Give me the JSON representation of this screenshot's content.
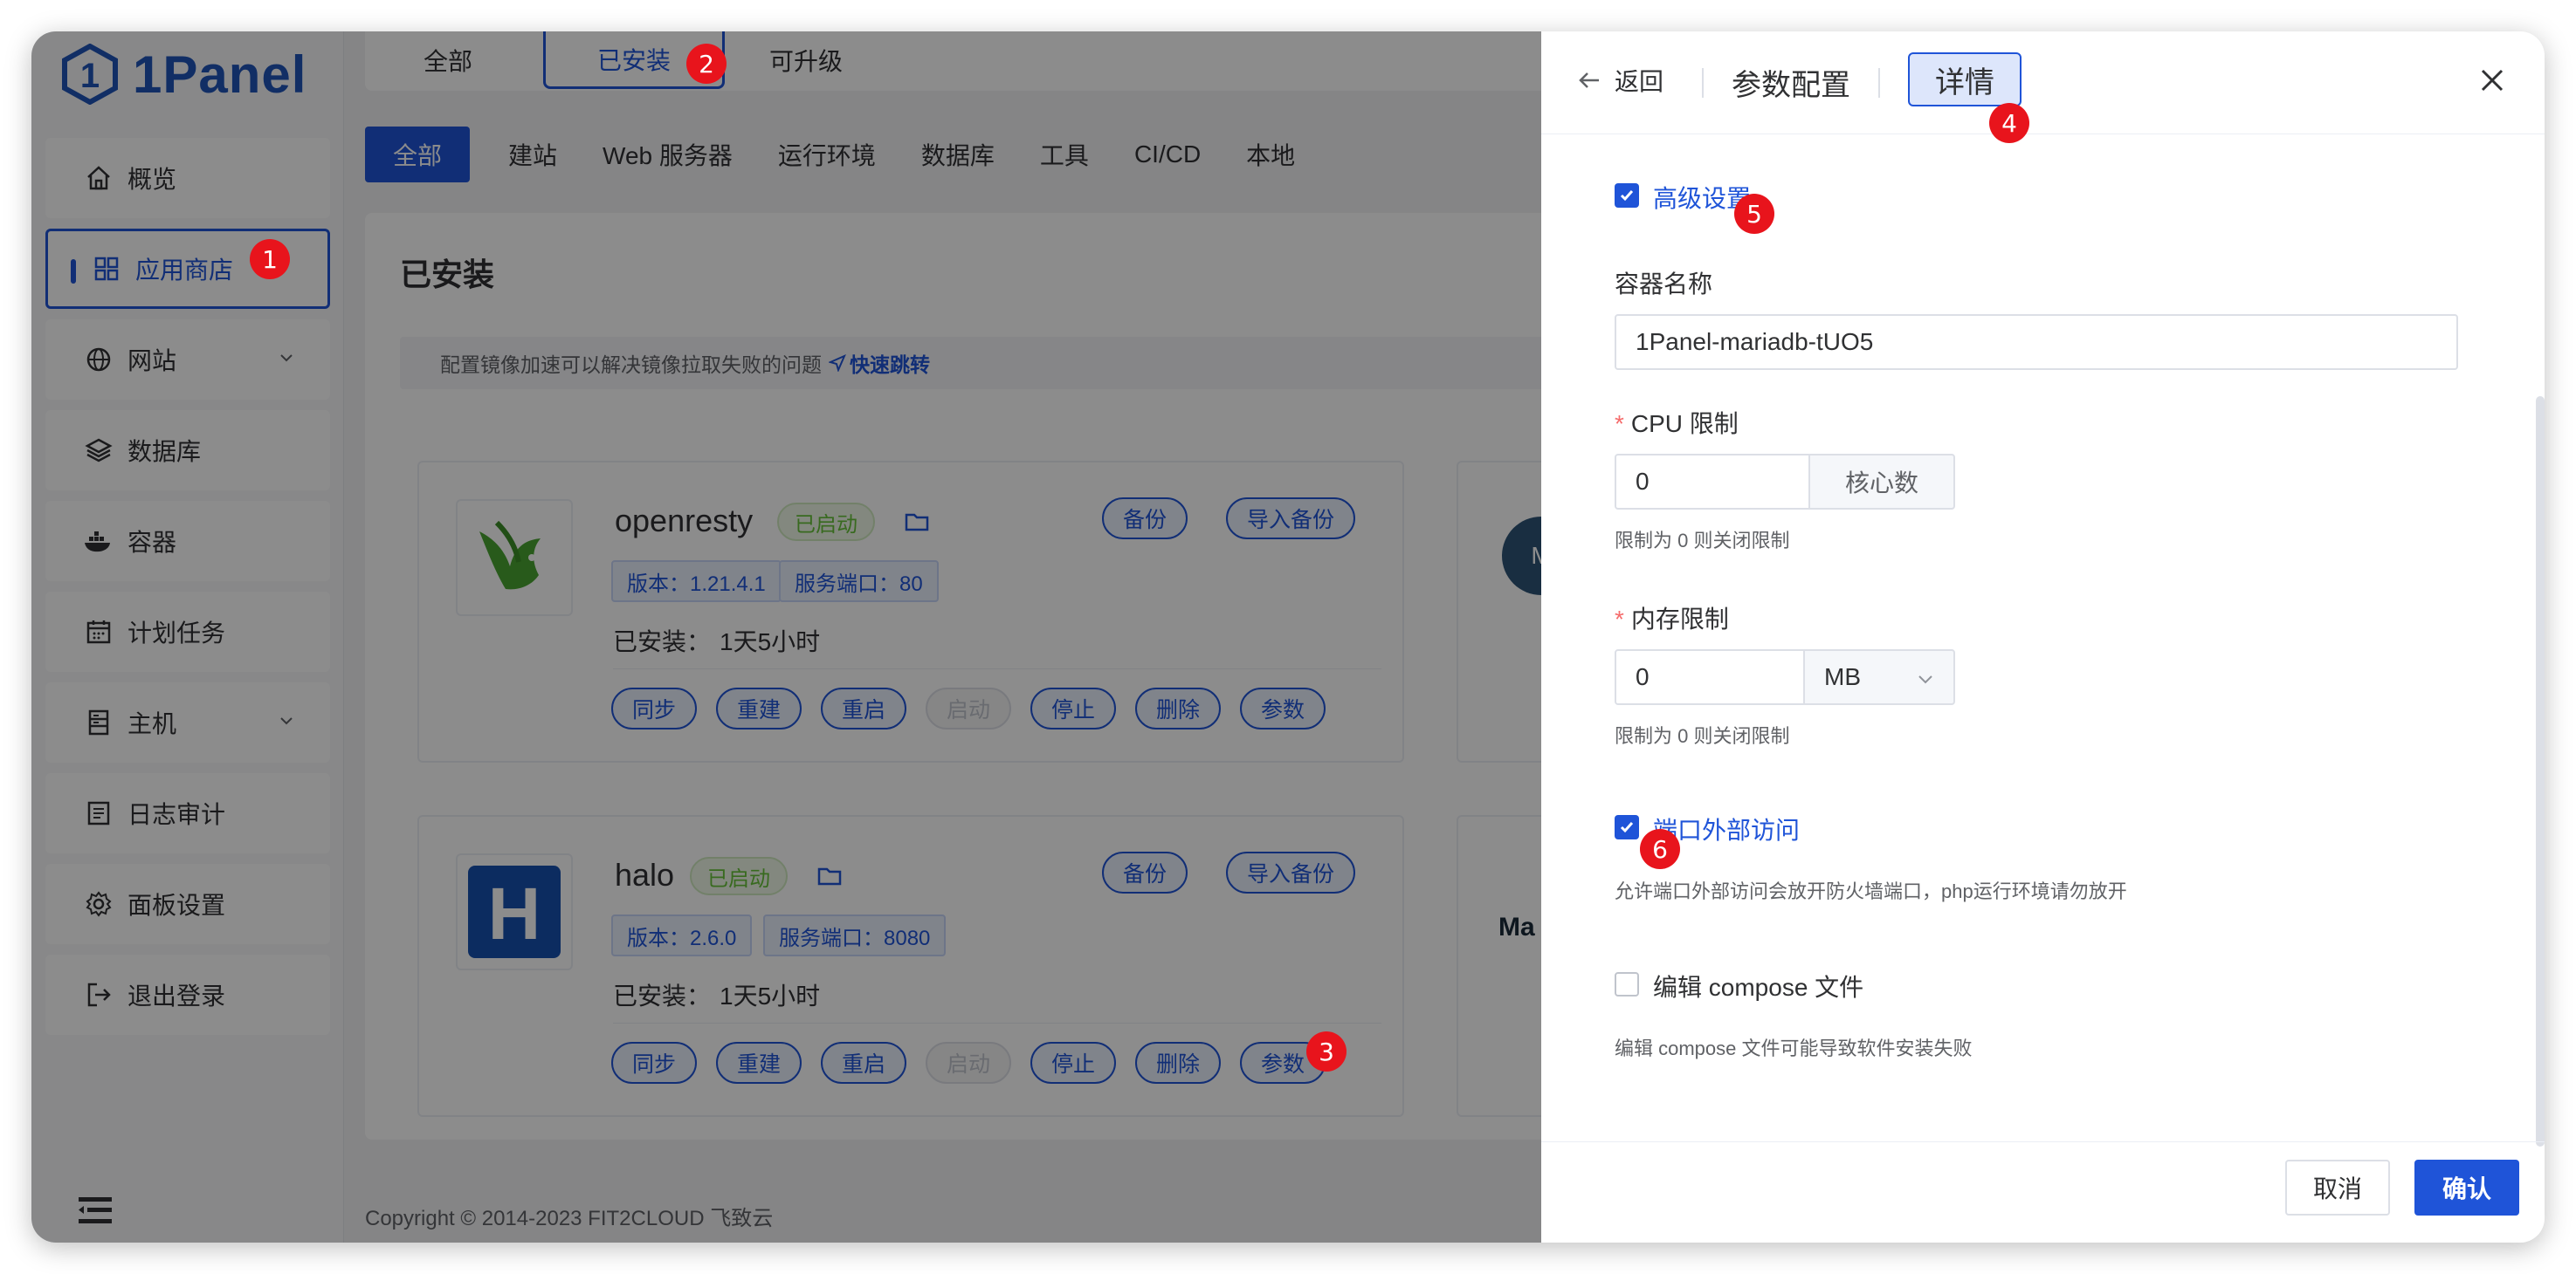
{
  "brand": {
    "name": "1Panel",
    "color": "#1f54d8"
  },
  "sidebar": {
    "items": [
      {
        "label": "概览",
        "icon": "home-icon"
      },
      {
        "label": "应用商店",
        "icon": "grid-icon",
        "active": true
      },
      {
        "label": "网站",
        "icon": "globe-icon",
        "expandable": true
      },
      {
        "label": "数据库",
        "icon": "layers-icon"
      },
      {
        "label": "容器",
        "icon": "docker-icon"
      },
      {
        "label": "计划任务",
        "icon": "calendar-icon"
      },
      {
        "label": "主机",
        "icon": "server-icon",
        "expandable": true
      },
      {
        "label": "日志审计",
        "icon": "log-icon"
      },
      {
        "label": "面板设置",
        "icon": "gear-icon"
      },
      {
        "label": "退出登录",
        "icon": "logout-icon"
      }
    ]
  },
  "main": {
    "top_tabs": [
      "全部",
      "已安装",
      "可升级"
    ],
    "categories": [
      "全部",
      "建站",
      "Web 服务器",
      "运行环境",
      "数据库",
      "工具",
      "CI/CD",
      "本地"
    ],
    "panel_title": "已安装",
    "mirror_tip": "配置镜像加速可以解决镜像拉取失败的问题",
    "mirror_link": "快速跳转",
    "apps": [
      {
        "name": "openresty",
        "status": "已启动",
        "version": "版本：1.21.4.1",
        "port": "服务端口：80",
        "installed_label": "已安装：",
        "installed_time": "1天5小时",
        "top_buttons": [
          "备份",
          "导入备份"
        ],
        "op_buttons": [
          "同步",
          "重建",
          "重启",
          "启动",
          "停止",
          "删除",
          "参数"
        ]
      },
      {
        "name": "halo",
        "status": "已启动",
        "version": "版本：2.6.0",
        "port": "服务端口：8080",
        "installed_label": "已安装：",
        "installed_time": "1天5小时",
        "top_buttons": [
          "备份",
          "导入备份"
        ],
        "op_buttons": [
          "同步",
          "重建",
          "重启",
          "启动",
          "停止",
          "删除",
          "参数"
        ]
      }
    ],
    "right_card_fragments": [
      "M",
      "Ma"
    ],
    "copyright": "Copyright © 2014-2023 FIT2CLOUD 飞致云"
  },
  "drawer": {
    "back": "返回",
    "title": "参数配置",
    "detail": "详情",
    "advanced": {
      "label": "高级设置",
      "checked": true
    },
    "container_name": {
      "label": "容器名称",
      "value": "1Panel-mariadb-tUO5"
    },
    "cpu": {
      "label": "CPU 限制",
      "value": "0",
      "suffix": "核心数",
      "hint": "限制为 0 则关闭限制"
    },
    "memory": {
      "label": "内存限制",
      "value": "0",
      "unit": "MB",
      "hint": "限制为 0 则关闭限制"
    },
    "external_access": {
      "label": "端口外部访问",
      "checked": true,
      "hint": "允许端口外部访问会放开防火墙端口，php运行环境请勿放开"
    },
    "edit_compose": {
      "label": "编辑 compose 文件",
      "checked": false,
      "hint": "编辑 compose 文件可能导致软件安装失败"
    },
    "cancel": "取消",
    "confirm": "确认"
  },
  "markers": [
    "1",
    "2",
    "3",
    "4",
    "5",
    "6"
  ]
}
